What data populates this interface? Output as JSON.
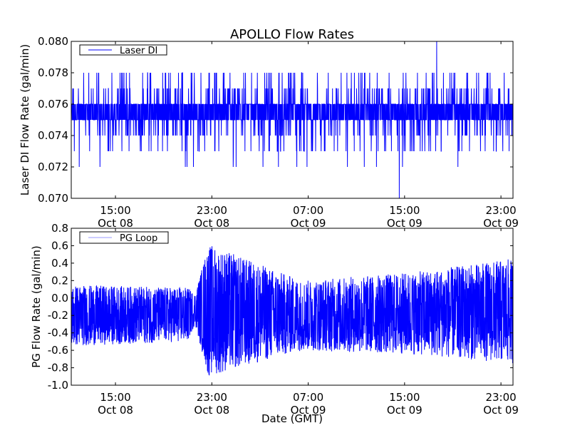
{
  "title": "APOLLO Flow Rates",
  "chart_data": [
    {
      "type": "line",
      "ylabel": "Laser DI Flow Rate (gal/min)",
      "xlabel": "",
      "ylim": [
        0.07,
        0.08
      ],
      "xlim_hours_since_oct08": [
        11.33,
        48.0
      ],
      "yticks": [
        0.07,
        0.072,
        0.074,
        0.076,
        0.078,
        0.08
      ],
      "ytick_labels": [
        "0.070",
        "0.072",
        "0.074",
        "0.076",
        "0.078",
        "0.080"
      ],
      "xticks_hours": [
        15,
        23,
        31,
        39,
        47
      ],
      "xtick_labels": [
        [
          "15:00",
          "Oct 08"
        ],
        [
          "23:00",
          "Oct 08"
        ],
        [
          "07:00",
          "Oct 09"
        ],
        [
          "15:00",
          "Oct 09"
        ],
        [
          "23:00",
          "Oct 09"
        ]
      ],
      "legend": {
        "label": "Laser DI",
        "placement": "upper-left"
      },
      "series": [
        {
          "name": "Laser DI",
          "color": "#0000ff",
          "baseline": [
            0.075,
            0.076
          ],
          "typical_range": [
            0.073,
            0.079
          ],
          "extremes": [
            0.07,
            0.08
          ]
        }
      ]
    },
    {
      "type": "line",
      "ylabel": "PG Flow Rate (gal/min)",
      "xlabel": "Date (GMT)",
      "ylim": [
        -1.0,
        0.8
      ],
      "xlim_hours_since_oct08": [
        11.33,
        48.0
      ],
      "yticks": [
        -1.0,
        -0.8,
        -0.6,
        -0.4,
        -0.2,
        0.0,
        0.2,
        0.4,
        0.6,
        0.8
      ],
      "ytick_labels": [
        "-1.0",
        "-0.8",
        "-0.6",
        "-0.4",
        "-0.2",
        "0.0",
        "0.2",
        "0.4",
        "0.6",
        "0.8"
      ],
      "xticks_hours": [
        15,
        23,
        31,
        39,
        47
      ],
      "xtick_labels": [
        [
          "15:00",
          "Oct 08"
        ],
        [
          "23:00",
          "Oct 08"
        ],
        [
          "07:00",
          "Oct 09"
        ],
        [
          "15:00",
          "Oct 09"
        ],
        [
          "23:00",
          "Oct 09"
        ]
      ],
      "legend": {
        "label": "PG Loop",
        "placement": "upper-left"
      },
      "series": [
        {
          "name": "PG Loop",
          "color": "#0000ff",
          "envelope_hours": [
            11.33,
            21.0,
            21.6,
            22.7,
            30.5,
            40.0,
            48.0
          ],
          "envelope_min": [
            -0.55,
            -0.5,
            -0.3,
            -0.9,
            -0.6,
            -0.65,
            -0.75
          ],
          "envelope_max": [
            0.15,
            0.12,
            0.05,
            0.62,
            0.2,
            0.3,
            0.45
          ]
        }
      ]
    }
  ]
}
